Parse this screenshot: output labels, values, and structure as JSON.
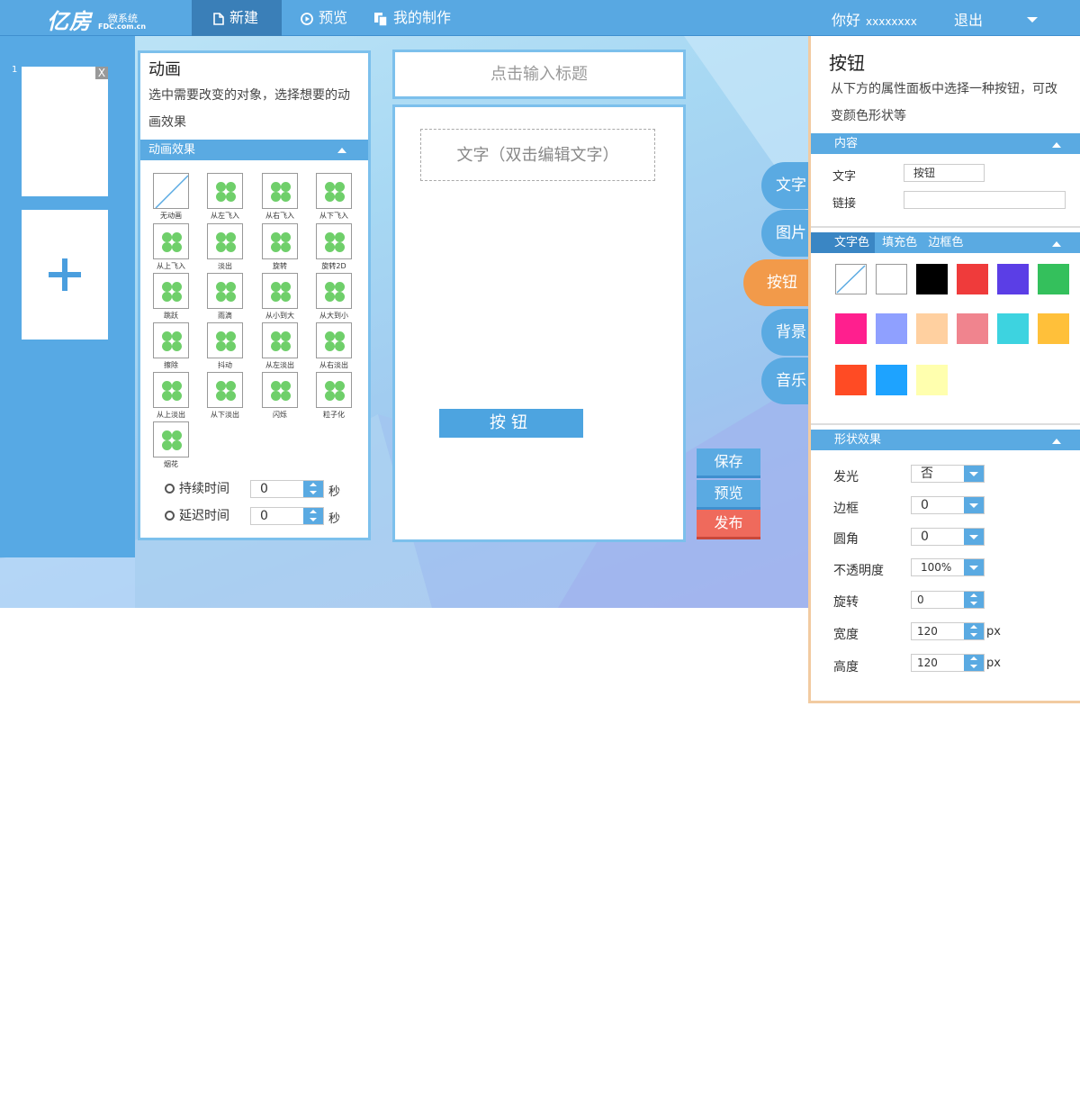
{
  "header": {
    "logo_text": "亿房",
    "logo_sub1": "微系统",
    "logo_sub2": "FDC.com.cn",
    "nav": [
      {
        "label": "新建",
        "icon": "file-icon"
      },
      {
        "label": "预览",
        "icon": "play-icon"
      },
      {
        "label": "我的制作",
        "icon": "copy-icon"
      }
    ],
    "greeting": "你好",
    "username": "xxxxxxxx",
    "logout": "退出"
  },
  "pages": {
    "first_page_number": "1",
    "delete_label": "X"
  },
  "animation": {
    "title": "动画",
    "description": "选中需要改变的对象，选择想要的动画效果",
    "section_title": "动画效果",
    "effects": [
      "无动画",
      "从左飞入",
      "从右飞入",
      "从下飞入",
      "从上飞入",
      "淡出",
      "旋转",
      "旋转2D",
      "跳跃",
      "雨滴",
      "从小到大",
      "从大到小",
      "擦除",
      "抖动",
      "从左淡出",
      "从右淡出",
      "从上淡出",
      "从下淡出",
      "闪烁",
      "粒子化",
      "烟花"
    ],
    "duration_label": "持续时间",
    "duration_value": "0",
    "delay_label": "延迟时间",
    "delay_value": "0",
    "seconds_unit": "秒"
  },
  "canvas": {
    "title_placeholder": "点击输入标题",
    "text_placeholder": "文字（双击编辑文字）",
    "button_text": "按钮"
  },
  "side_tabs": [
    "文字",
    "图片",
    "按钮",
    "背景",
    "音乐"
  ],
  "actions": {
    "save": "保存",
    "preview": "预览",
    "publish": "发布"
  },
  "properties": {
    "title": "按钮",
    "description": "从下方的属性面板中选择一种按钮，可改变颜色形状等",
    "content_section": "内容",
    "text_label": "文字",
    "text_value": "按钮",
    "link_label": "链接",
    "link_value": "",
    "color_tabs": [
      "文字色",
      "填充色",
      "边框色"
    ],
    "colors": [
      "none",
      "#ffffff",
      "#000000",
      "#ef3b3b",
      "#5b3ee6",
      "#34c05c",
      "#ff1f8e",
      "#8fa0ff",
      "#ffd0a0",
      "#f0848e",
      "#3dd3e0",
      "#ffc03a",
      "#ff4b24",
      "#1ea3ff",
      "#ffffae"
    ],
    "shape_section": "形状效果",
    "glow_label": "发光",
    "glow_value": "否",
    "border_label": "边框",
    "border_value": "0",
    "radius_label": "圆角",
    "radius_value": "0",
    "opacity_label": "不透明度",
    "opacity_value": "100%",
    "rotate_label": "旋转",
    "rotate_value": "0",
    "width_label": "宽度",
    "width_value": "120",
    "height_label": "高度",
    "height_value": "120",
    "px_unit": "px"
  }
}
